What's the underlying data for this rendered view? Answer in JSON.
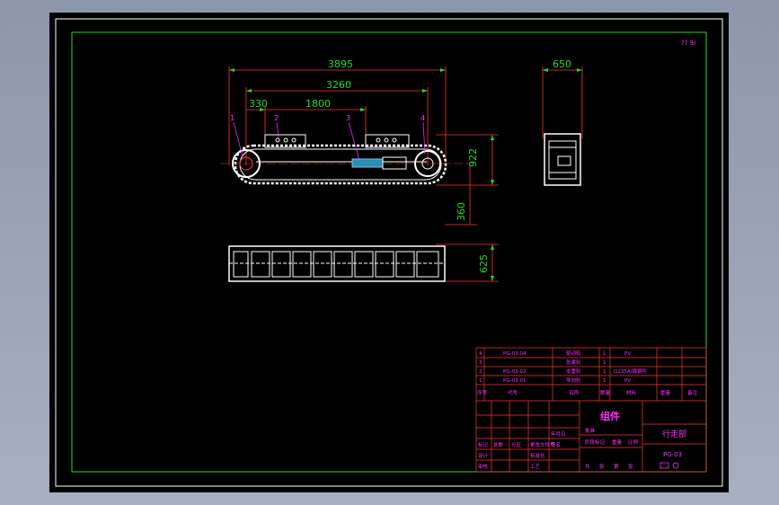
{
  "drawing": {
    "corner_mark": "?? 9/",
    "dimensions": {
      "total_length": "3895",
      "wheelbase": "3260",
      "offset": "330",
      "span": "1800",
      "width_top": "650",
      "height": "922",
      "clearance": "360",
      "track_width": "625"
    },
    "callouts": [
      "1",
      "2",
      "3",
      "4"
    ]
  },
  "title_block": {
    "parts": [
      {
        "no": "4",
        "code": "PG-03-04",
        "name": "驱动轮",
        "qty": "1",
        "material": "PV"
      },
      {
        "no": "3",
        "code": "",
        "name": "张紧轮",
        "qty": "1",
        "material": ""
      },
      {
        "no": "2",
        "code": "PG-03-02",
        "name": "支重轮",
        "qty": "1",
        "material": "Q235A/铸钢件"
      },
      {
        "no": "1",
        "code": "PG-03-01",
        "name": "导向轮",
        "qty": "1",
        "material": "PV"
      }
    ],
    "header": {
      "no": "序号",
      "code": "代号",
      "name": "名称",
      "qty": "数量",
      "material": "材料",
      "weight": "重量",
      "remark": "备注"
    },
    "assembly_label": "组件",
    "product_name": "行走部",
    "drawing_no": "PG-03",
    "sign_rows": [
      "标记",
      "设计",
      "审核",
      "工艺"
    ],
    "sign_cols": [
      "处数",
      "分区",
      "更改文件号",
      "签名",
      "年月日"
    ],
    "stage_labels": [
      "阶段标记",
      "重量",
      "比例"
    ],
    "sheet_labels": [
      "共",
      "张",
      "第",
      "张"
    ],
    "std_label": "标准化",
    "approve_label": "批准"
  }
}
